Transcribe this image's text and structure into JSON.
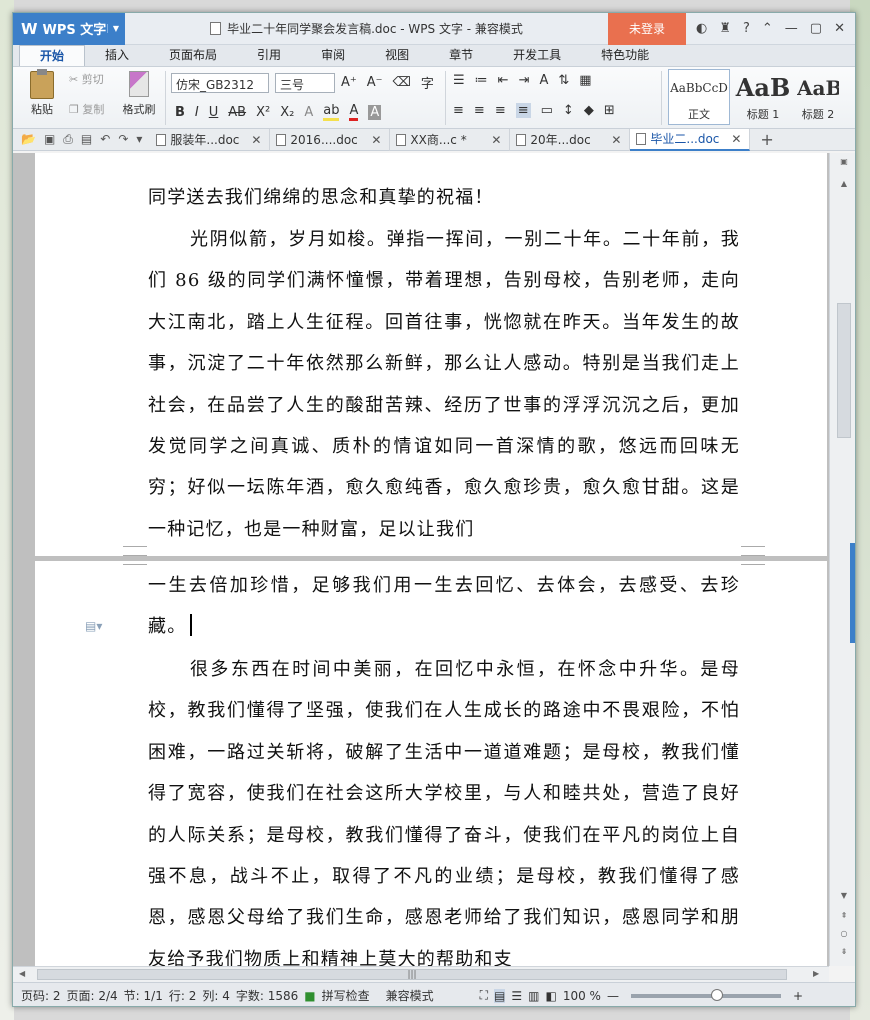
{
  "window": {
    "app_button": "WPS 文字",
    "title": "毕业二十年同学聚会发言稿.doc - WPS 文字 - 兼容模式",
    "login": "未登录"
  },
  "ribbon_tabs": [
    "开始",
    "插入",
    "页面布局",
    "引用",
    "审阅",
    "视图",
    "章节",
    "开发工具",
    "特色功能"
  ],
  "ribbon": {
    "paste": "粘贴",
    "cut": "剪切",
    "copy": "复制",
    "format_painter": "格式刷",
    "font_name": "仿宋_GB2312",
    "font_size": "三号",
    "styles": [
      {
        "sample": "AaBbCcD",
        "name": "正文"
      },
      {
        "sample": "AaB",
        "name": "标题 1"
      },
      {
        "sample": "AaB",
        "name": "标题 2"
      }
    ]
  },
  "doc_tabs": [
    {
      "label": "服装年...doc"
    },
    {
      "label": "2016....doc"
    },
    {
      "label": "XX商...c *"
    },
    {
      "label": "20年...doc"
    },
    {
      "label": "毕业二...doc"
    }
  ],
  "page1": {
    "p1": "同学送去我们绵绵的思念和真挚的祝福！",
    "p2": "光阴似箭，岁月如梭。弹指一挥间，一别二十年。二十年前，我们 86 级的同学们满怀憧憬，带着理想，告别母校，告别老师，走向大江南北，踏上人生征程。回首往事，恍惚就在昨天。当年发生的故事，沉淀了二十年依然那么新鲜，那么让人感动。特别是当我们走上社会，在品尝了人生的酸甜苦辣、经历了世事的浮浮沉沉之后，更加发觉同学之间真诚、质朴的情谊如同一首深情的歌，悠远而回味无穷；好似一坛陈年酒，愈久愈纯香，愈久愈珍贵，愈久愈甘甜。这是一种记忆，也是一种财富，足以让我们"
  },
  "page2": {
    "p1": "一生去倍加珍惜，足够我们用一生去回忆、去体会，去感受、去珍藏。",
    "p2": "很多东西在时间中美丽，在回忆中永恒，在怀念中升华。是母校，教我们懂得了坚强，使我们在人生成长的路途中不畏艰险，不怕困难，一路过关斩将，破解了生活中一道道难题；是母校，教我们懂得了宽容，使我们在社会这所大学校里，与人和睦共处，营造了良好的人际关系；是母校，教我们懂得了奋斗，使我们在平凡的岗位上自强不息，战斗不止，取得了不凡的业绩；是母校，教我们懂得了感恩，感恩父母给了我们生命，感恩老师给了我们知识，感恩同学和朋友给予我们物质上和精神上莫大的帮助和支"
  },
  "status": {
    "page_code": "页码: 2",
    "pages": "页面: 2/4",
    "section": "节: 1/1",
    "row": "行: 2",
    "col": "列: 4",
    "words": "字数: 1586",
    "spell": "拼写检查",
    "mode": "兼容模式",
    "zoom": "100 %"
  }
}
